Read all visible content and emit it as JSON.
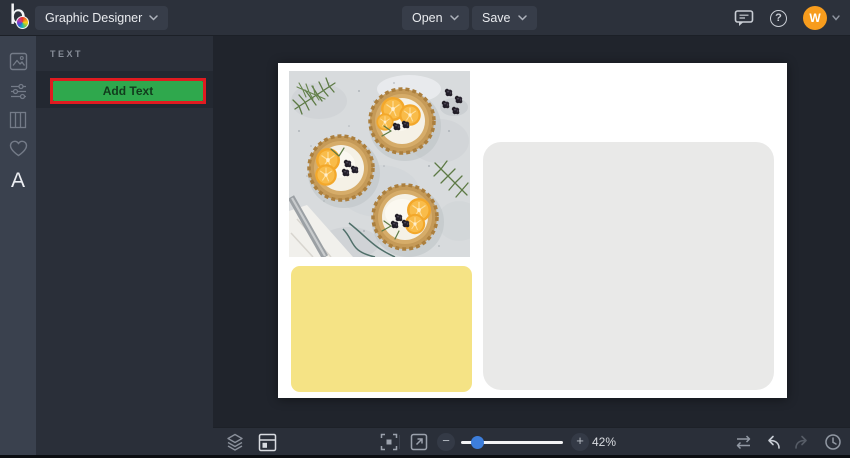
{
  "topbar": {
    "app_menu_label": "Graphic Designer",
    "open_label": "Open",
    "save_label": "Save",
    "avatar_initial": "W",
    "help_glyph": "?"
  },
  "rail": {
    "items": [
      "photos",
      "adjustments",
      "templates",
      "favorites",
      "text"
    ],
    "text_tool_glyph": "A"
  },
  "panel": {
    "title": "TEXT",
    "add_text_label": "Add Text"
  },
  "zoom": {
    "level": "42%",
    "minus_glyph": "−",
    "plus_glyph": "+"
  },
  "canvas": {
    "artboard": {
      "shapes": [
        "food-photo",
        "yellow-rounded-rect",
        "gray-rounded-rect"
      ],
      "yellow_color": "#f5e385",
      "gray_color": "#e9e9e8"
    }
  },
  "colors": {
    "topbar_bg": "#2c313b",
    "panel_bg": "#2a2f39",
    "canvas_bg": "#20242c",
    "accent_green": "#2fa84d",
    "annotation_red": "#e01b20",
    "avatar_orange": "#f79c1d",
    "slider_blue": "#3d7edb"
  },
  "icons": [
    "befunky-logo",
    "chevron-down-icon",
    "feedback-icon",
    "help-icon",
    "photos-icon",
    "adjustments-icon",
    "templates-icon",
    "favorites-icon",
    "text-icon",
    "layers-icon",
    "layout-manager-icon",
    "fit-screen-icon",
    "preview-icon",
    "zoom-out-icon",
    "zoom-in-icon",
    "compare-icon",
    "undo-icon",
    "redo-icon",
    "history-icon"
  ]
}
